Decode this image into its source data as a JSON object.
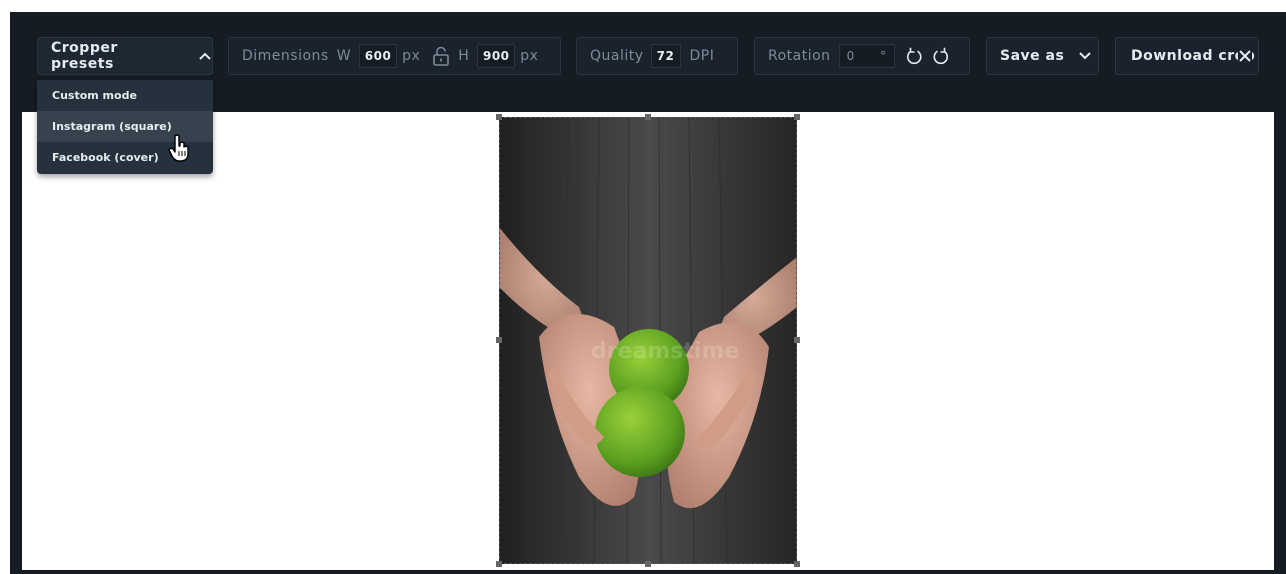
{
  "toolbar": {
    "presets_label": "Cropper presets",
    "dimensions_label": "Dimensions",
    "width_prefix": "W",
    "width_value": "600",
    "width_unit": "px",
    "height_prefix": "H",
    "height_value": "900",
    "height_unit": "px",
    "quality_label": "Quality",
    "quality_value": "72",
    "quality_unit": "DPI",
    "rotation_label": "Rotation",
    "rotation_value": "0",
    "rotation_unit": "°",
    "save_as_label": "Save as",
    "download_label": "Download crop"
  },
  "presets_menu": {
    "items": [
      "Custom mode",
      "Instagram (square)",
      "Facebook (cover)"
    ],
    "hovered_index": 1
  },
  "image": {
    "watermark_text": "dreamstime"
  },
  "colors": {
    "toolbar_bg": "#151c24",
    "group_border": "#2a3642",
    "text_muted": "#7d8b98",
    "text_light": "#e6ebf0",
    "menu_bg": "#25313d",
    "menu_hover": "#36434f"
  },
  "icons": {
    "presets_toggle": "chevron-up-icon",
    "lock": "unlock-icon",
    "rotate_left": "rotate-left-icon",
    "rotate_right": "rotate-right-icon",
    "save_dropdown": "chevron-down-icon",
    "close": "close-icon",
    "cursor": "hand-pointer-icon"
  }
}
